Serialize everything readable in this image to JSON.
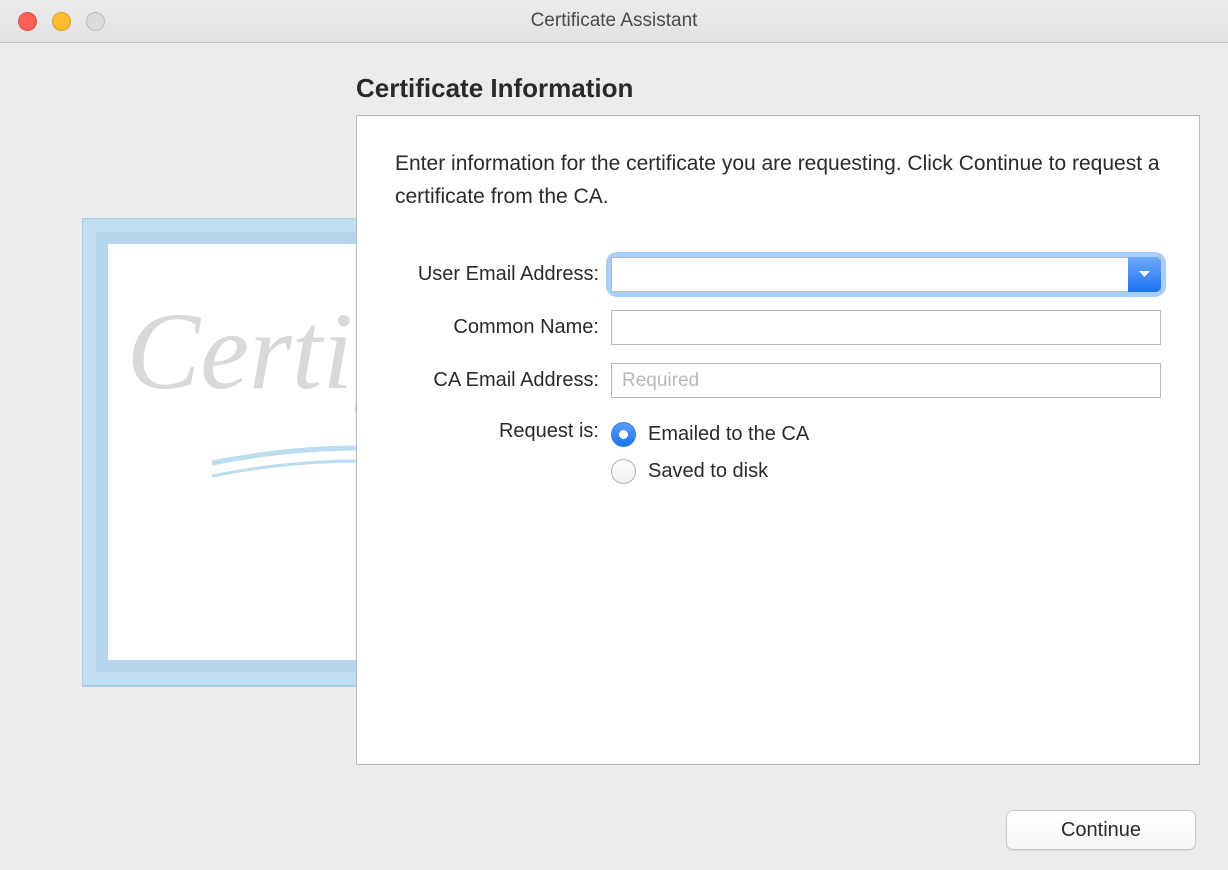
{
  "window": {
    "title": "Certificate Assistant"
  },
  "page": {
    "heading": "Certificate Information",
    "instructions": "Enter information for the certificate you are requesting. Click Continue to request a certificate from the CA."
  },
  "form": {
    "user_email": {
      "label": "User Email Address:",
      "value": ""
    },
    "common_name": {
      "label": "Common Name:",
      "value": ""
    },
    "ca_email": {
      "label": "CA Email Address:",
      "placeholder": "Required",
      "value": ""
    },
    "request_is": {
      "label": "Request is:",
      "options": [
        {
          "label": "Emailed to the CA",
          "checked": true
        },
        {
          "label": "Saved to disk",
          "checked": false
        }
      ]
    }
  },
  "footer": {
    "continue_label": "Continue"
  }
}
